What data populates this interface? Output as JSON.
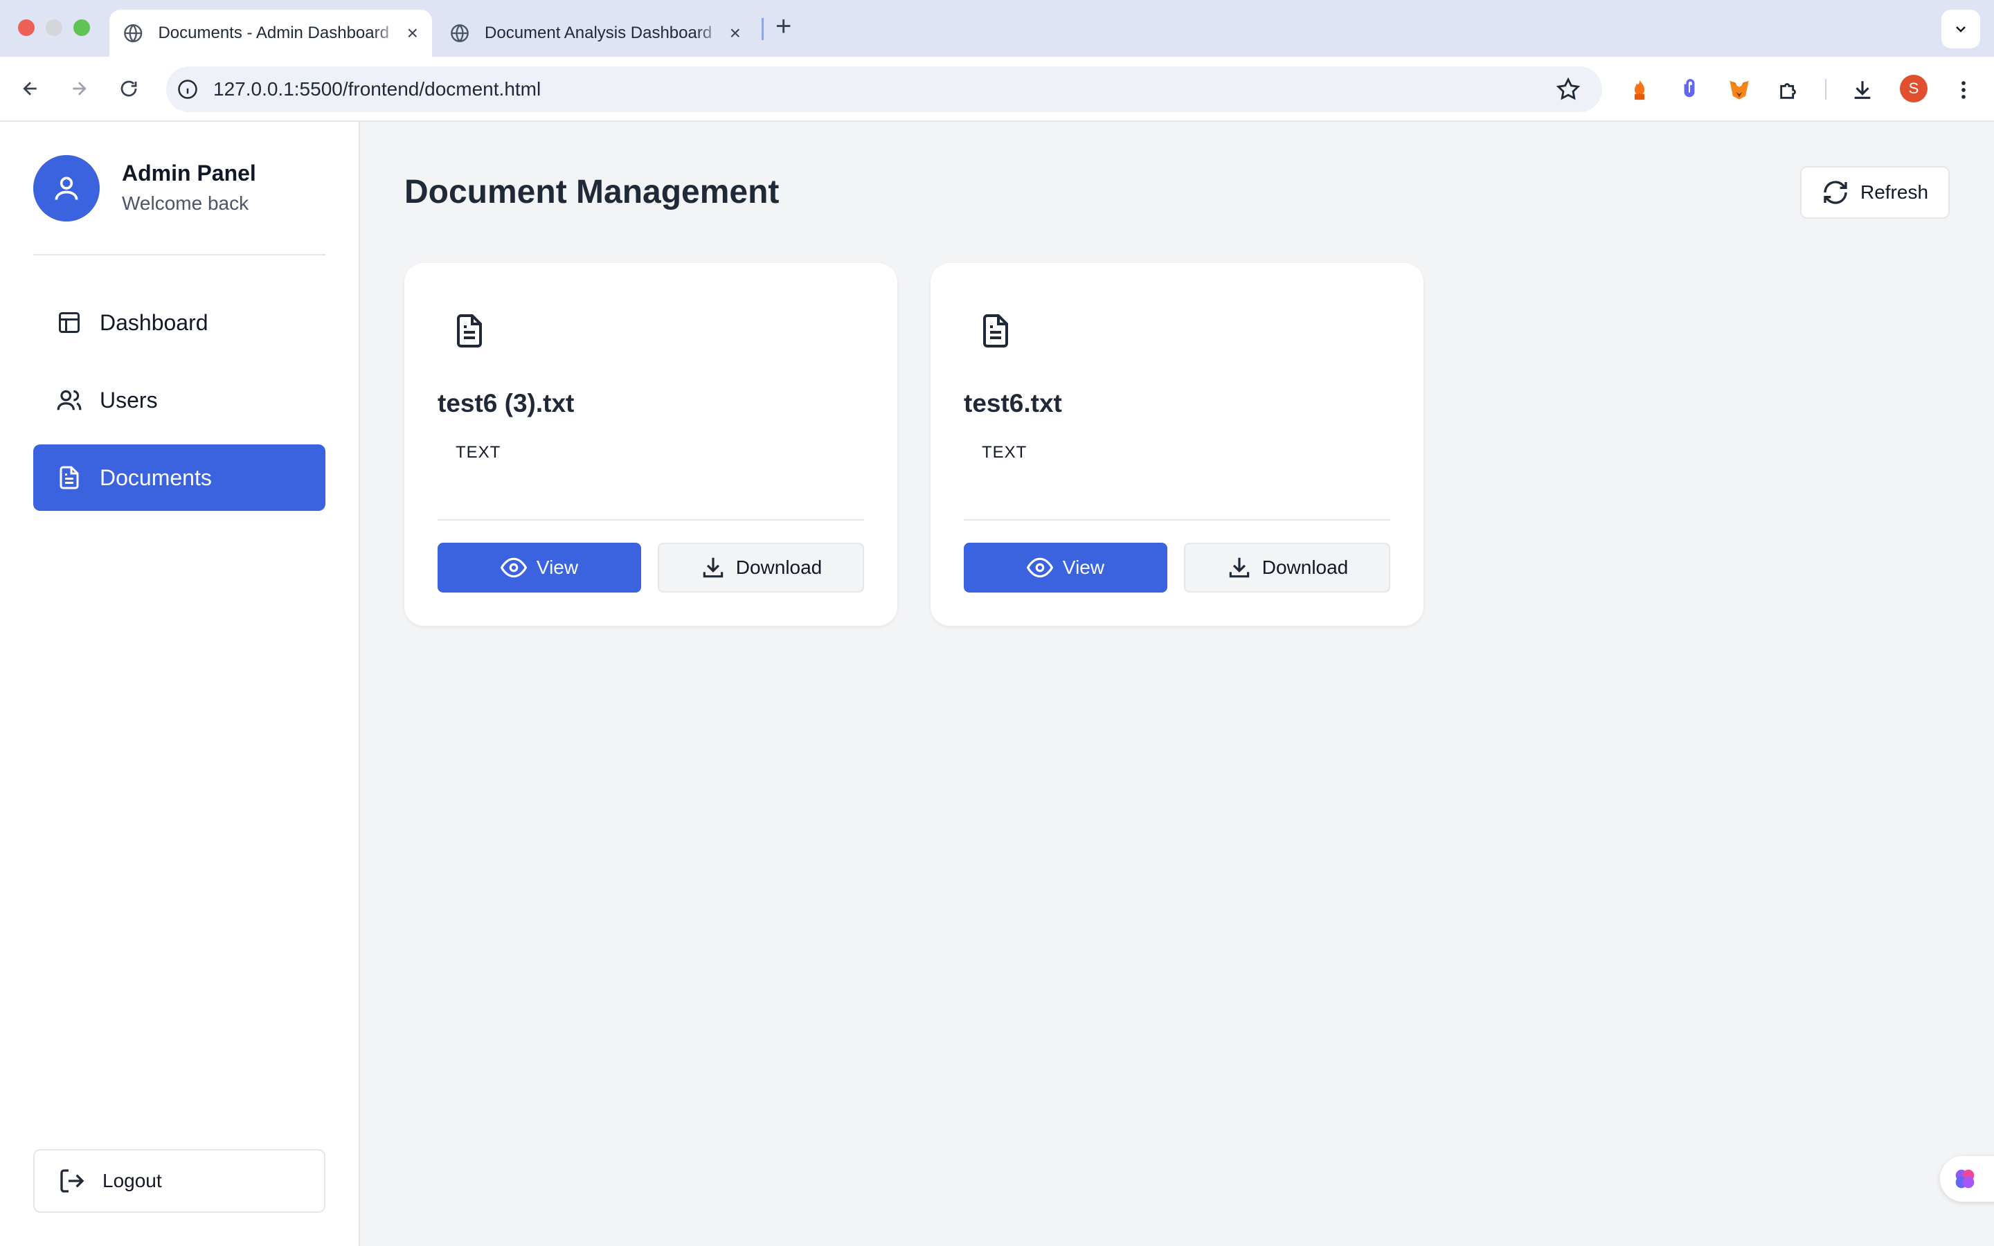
{
  "browser": {
    "tabs": [
      {
        "title": "Documents - Admin Dashboard",
        "active": true
      },
      {
        "title": "Document Analysis Dashboard",
        "active": false
      }
    ],
    "url": "127.0.0.1:5500/frontend/docment.html",
    "profile_initial": "S"
  },
  "sidebar": {
    "title": "Admin Panel",
    "subtitle": "Welcome back",
    "items": [
      {
        "label": "Dashboard",
        "icon": "layout-icon",
        "active": false
      },
      {
        "label": "Users",
        "icon": "users-icon",
        "active": false
      },
      {
        "label": "Documents",
        "icon": "file-text-icon",
        "active": true
      }
    ],
    "logout_label": "Logout"
  },
  "main": {
    "title": "Document Management",
    "refresh_label": "Refresh",
    "documents": [
      {
        "name": "test6 (3).txt",
        "type": "TEXT",
        "view_label": "View",
        "download_label": "Download"
      },
      {
        "name": "test6.txt",
        "type": "TEXT",
        "view_label": "View",
        "download_label": "Download"
      }
    ]
  },
  "colors": {
    "accent": "#3b63df",
    "background": "#f3f4f6",
    "card": "#ffffff"
  }
}
